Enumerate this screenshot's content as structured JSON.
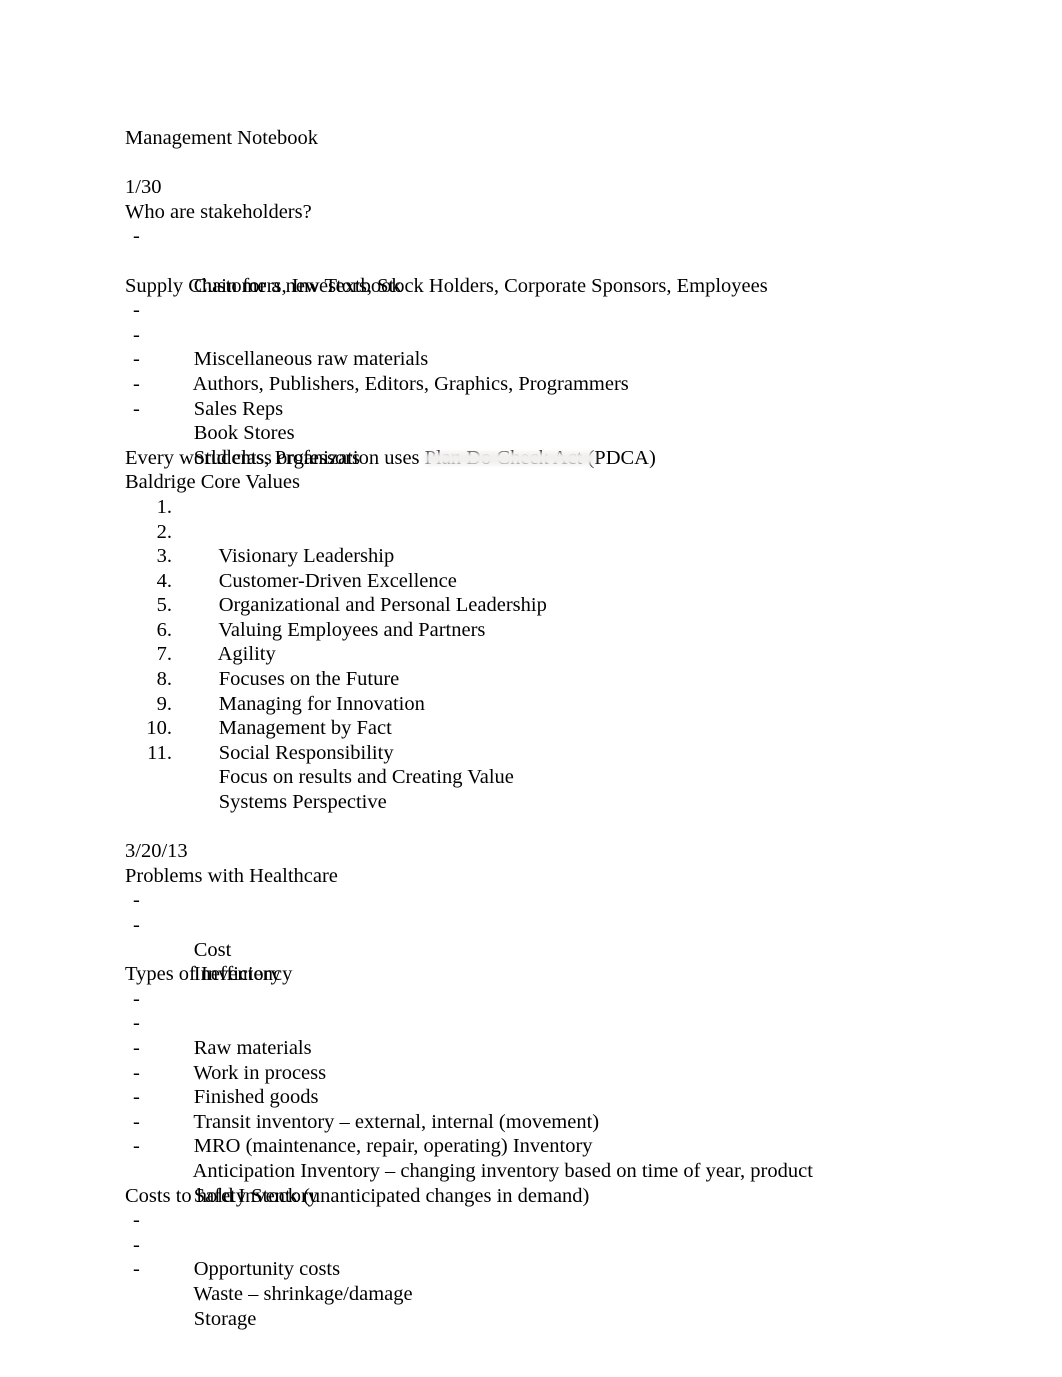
{
  "document": {
    "title": "Management Notebook",
    "background_color": "#ffffff",
    "text_color": "#000000",
    "dash_bullet": "-",
    "sections": [
      {
        "date": "1/30",
        "blocks": [
          {
            "heading": "Who are stakeholders?",
            "dash_items": [
              "Customers, Investors, Stock Holders, Corporate Sponsors, Employees"
            ]
          },
          {
            "heading": "Supply Chain for a new Textbook",
            "dash_items": [
              "Miscellaneous raw materials",
              "Authors, Publishers, Editors, Graphics, Programmers",
              "Sales Reps",
              "Book Stores",
              "Students, Professors"
            ]
          },
          {
            "statement": "Every world class organization uses Plan Do Check Act (PDCA)",
            "heading": "Baldrige Core Values",
            "numbered_items": [
              {
                "number": "1.",
                "text": "Visionary Leadership"
              },
              {
                "number": "2.",
                "text": "Customer-Driven Excellence"
              },
              {
                "number": "3.",
                "text": "Organizational and Personal Leadership"
              },
              {
                "number": "4.",
                "text": "Valuing Employees and Partners"
              },
              {
                "number": "5.",
                "text": "Agility"
              },
              {
                "number": "6.",
                "text": "Focuses on the Future"
              },
              {
                "number": "7.",
                "text": "Managing for Innovation"
              },
              {
                "number": "8.",
                "text": "Management by Fact"
              },
              {
                "number": "9.",
                "text": "Social Responsibility"
              },
              {
                "number": "10.",
                "text": "Focus on results and Creating Value"
              },
              {
                "number": "11.",
                "text": "Systems Perspective"
              }
            ]
          }
        ]
      },
      {
        "date": "3/20/13",
        "blocks": [
          {
            "heading": "Problems with Healthcare",
            "dash_items": [
              "Cost",
              "Inefficiency"
            ]
          },
          {
            "heading": "Types of Inventory",
            "dash_items": [
              "Raw materials",
              "Work in process",
              "Finished goods",
              "Transit inventory – external, internal (movement)",
              "MRO (maintenance, repair, operating) Inventory",
              "Anticipation Inventory – changing inventory based on time of year, product",
              "Safety Stock (unanticipated changes in demand)"
            ]
          },
          {
            "heading": "Costs to hold Inventory",
            "dash_items": [
              "Opportunity costs",
              "Waste – shrinkage/damage",
              "Storage"
            ]
          }
        ]
      }
    ]
  }
}
